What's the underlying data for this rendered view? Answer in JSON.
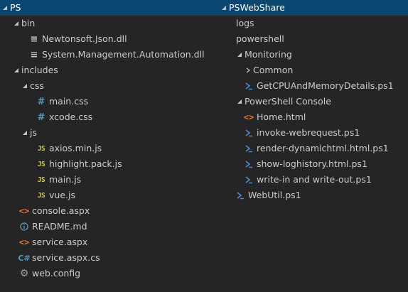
{
  "left": {
    "root": "PS",
    "items": [
      {
        "label": "bin"
      },
      {
        "label": "Newtonsoft.Json.dll"
      },
      {
        "label": "System.Management.Automation.dll"
      },
      {
        "label": "includes"
      },
      {
        "label": "css"
      },
      {
        "label": "main.css"
      },
      {
        "label": "xcode.css"
      },
      {
        "label": "js"
      },
      {
        "label": "axios.min.js"
      },
      {
        "label": "highlight.pack.js"
      },
      {
        "label": "main.js"
      },
      {
        "label": "vue.js"
      },
      {
        "label": "console.aspx"
      },
      {
        "label": "README.md"
      },
      {
        "label": "service.aspx"
      },
      {
        "label": "service.aspx.cs"
      },
      {
        "label": "web.config"
      }
    ]
  },
  "right": {
    "root": "PSWebShare",
    "items": [
      {
        "label": "logs"
      },
      {
        "label": "powershell"
      },
      {
        "label": "Monitoring"
      },
      {
        "label": "Common"
      },
      {
        "label": "GetCPUAndMemoryDetails.ps1"
      },
      {
        "label": "PowerShell Console"
      },
      {
        "label": "Home.html"
      },
      {
        "label": "invoke-webrequest.ps1"
      },
      {
        "label": "render-dynamichtml.html.ps1"
      },
      {
        "label": "show-loghistory.html.ps1"
      },
      {
        "label": "write-in and write-out.ps1"
      },
      {
        "label": "WebUtil.ps1"
      }
    ]
  },
  "icons": {
    "folder_expanded": "chevron-down-right-icon",
    "folder_collapsed": "chevron-right-icon",
    "dll": "file-lines-icon",
    "css": "hash-icon",
    "js": "js-icon",
    "markup": "angle-brackets-icon",
    "markdown": "info-icon",
    "csharp": "csharp-icon",
    "config": "gear-icon",
    "powershell": "powershell-icon"
  },
  "colors": {
    "background": "#252526",
    "selection": "#094771",
    "text": "#cccccc",
    "css_icon": "#519aba",
    "js_icon": "#cbcb41",
    "markup_icon": "#e37933",
    "powershell_icon": "#4c8dc9"
  }
}
